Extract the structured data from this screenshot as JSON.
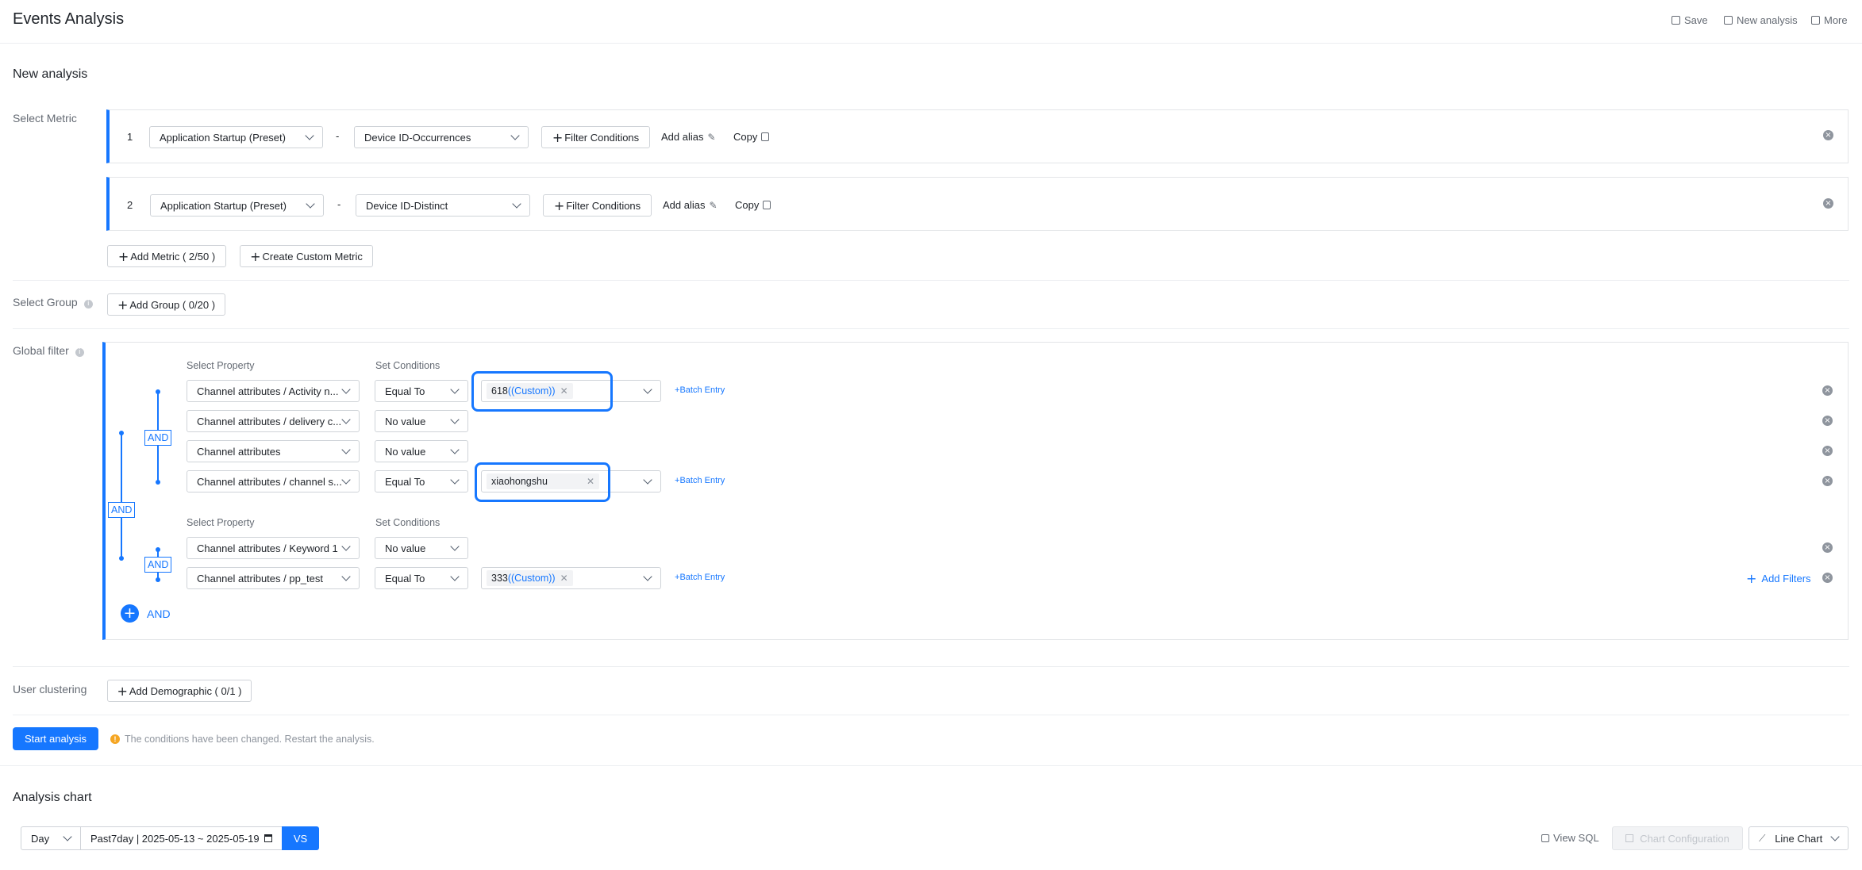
{
  "header": {
    "title": "Events Analysis",
    "save": "Save",
    "new_analysis": "New analysis",
    "more": "More"
  },
  "section_title": "New analysis",
  "metric": {
    "label": "Select Metric",
    "rows": [
      {
        "index": "1",
        "event": "Application Startup (Preset)",
        "dash": "-",
        "measure": "Device ID-Occurrences",
        "filter_btn": "Filter Conditions",
        "alias": "Add alias",
        "copy": "Copy"
      },
      {
        "index": "2",
        "event": "Application Startup (Preset)",
        "dash": "-",
        "measure": "Device ID-Distinct",
        "filter_btn": "Filter Conditions",
        "alias": "Add alias",
        "copy": "Copy"
      }
    ],
    "add_metric": "Add Metric ( 2/50 )",
    "custom_metric": "Create Custom Metric"
  },
  "group": {
    "label": "Select Group",
    "add": "Add Group ( 0/20 )"
  },
  "filter": {
    "label": "Global filter",
    "select_property": "Select Property",
    "set_conditions": "Set Conditions",
    "and": "AND",
    "rows": [
      {
        "property": "Channel attributes / Activity n...",
        "condition": "Equal To",
        "tag": "618",
        "tag_custom": "((Custom))",
        "batch": "Batch Entry"
      },
      {
        "property": "Channel attributes / delivery c...",
        "condition": "No value"
      },
      {
        "property": "Channel attributes",
        "condition": "No value"
      },
      {
        "property": "Channel attributes / channel s...",
        "condition": "Equal To",
        "tag": "xiaohongshu",
        "batch": "Batch Entry"
      },
      {
        "property": "Channel attributes / Keyword 1",
        "condition": "No value"
      },
      {
        "property": "Channel attributes / pp_test",
        "condition": "Equal To",
        "tag": "333",
        "tag_custom": "((Custom))",
        "batch": "Batch Entry"
      }
    ],
    "add_filters": "Add Filters",
    "add_and": "AND"
  },
  "clustering": {
    "label": "User clustering",
    "add": "Add Demographic ( 0/1 )"
  },
  "start": {
    "button": "Start analysis",
    "notice": "The conditions have been changed. Restart the analysis."
  },
  "chart": {
    "title": "Analysis chart",
    "granularity": "Day",
    "date_range": "Past7day | 2025-05-13 ~ 2025-05-19",
    "vs": "VS",
    "view_sql": "View SQL",
    "chart_config": "Chart Configuration",
    "chart_type": "Line Chart"
  },
  "colors": {
    "accent": "#1677ff",
    "warning": "#f5a623"
  }
}
